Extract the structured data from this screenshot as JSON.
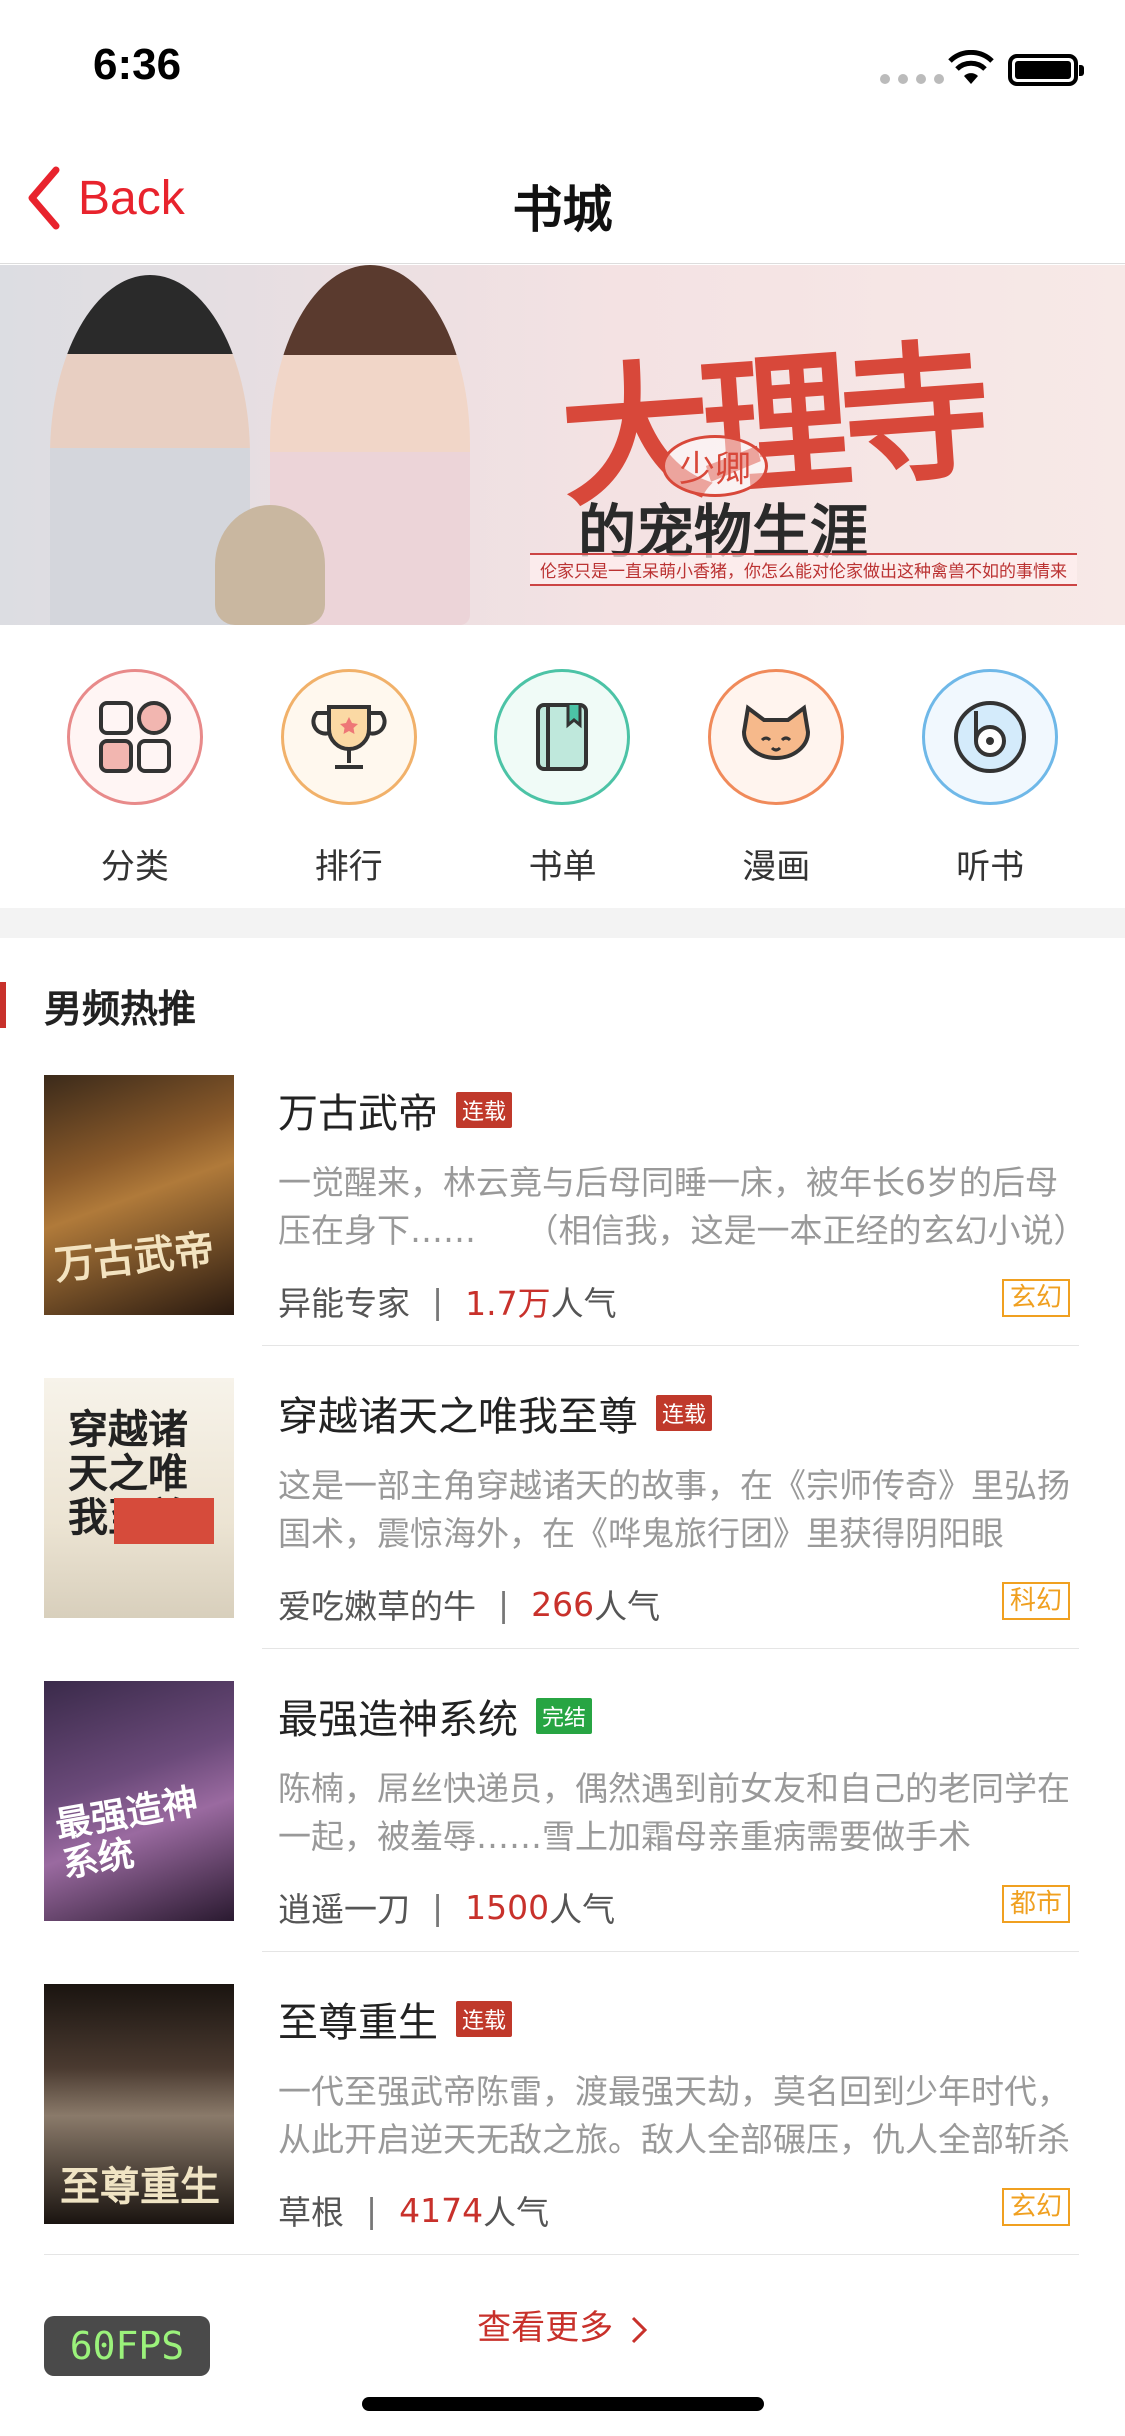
{
  "status": {
    "time": "6:36"
  },
  "nav": {
    "back_label": "Back",
    "title": "书城"
  },
  "banner": {
    "title": "大理寺",
    "badge": "少卿",
    "subtitle": "的宠物生涯",
    "caption": "伦家只是一直呆萌小香猪，你怎么能对伦家做出这种禽兽不如的事情来"
  },
  "categories": [
    {
      "label": "分类",
      "icon": "category-grid-icon",
      "color": "#e07a7a"
    },
    {
      "label": "排行",
      "icon": "trophy-icon",
      "color": "#f1b16a"
    },
    {
      "label": "书单",
      "icon": "book-icon",
      "color": "#4cc3a6"
    },
    {
      "label": "漫画",
      "icon": "cat-face-icon",
      "color": "#f08a5a"
    },
    {
      "label": "听书",
      "icon": "disc-icon",
      "color": "#6fb8e8"
    }
  ],
  "section": {
    "title": "男频热推"
  },
  "books": [
    {
      "title": "万古武帝",
      "status": "连载",
      "desc": "一觉醒来，林云竟与后母同睡一床，被年长6岁的后母压在身下……　　（相信我，这是一本正经的玄幻小说）",
      "author": "异能专家",
      "popularity": "1.7万",
      "pop_suffix": "人气",
      "genre": "玄幻"
    },
    {
      "title": "穿越诸天之唯我至尊",
      "status": "连载",
      "desc": "这是一部主角穿越诸天的故事，在《宗师传奇》里弘扬国术，震惊海外，在《哗鬼旅行团》里获得阴阳眼",
      "author": "爱吃嫩草的牛",
      "popularity": "266",
      "pop_suffix": "人气",
      "genre": "科幻"
    },
    {
      "title": "最强造神系统",
      "status": "完结",
      "desc": "陈楠，屌丝快递员，偶然遇到前女友和自己的老同学在一起，被羞辱……雪上加霜母亲重病需要做手术",
      "author": "逍遥一刀",
      "popularity": "1500",
      "pop_suffix": "人气",
      "genre": "都市"
    },
    {
      "title": "至尊重生",
      "status": "连载",
      "desc": "一代至强武帝陈雷，渡最强天劫，莫名回到少年时代，从此开启逆天无敌之旅。敌人全部碾压，仇人全部斩杀",
      "author": "草根",
      "popularity": "4174",
      "pop_suffix": "人气",
      "genre": "玄幻"
    }
  ],
  "more_label": "查看更多",
  "fps_label": "60FPS"
}
